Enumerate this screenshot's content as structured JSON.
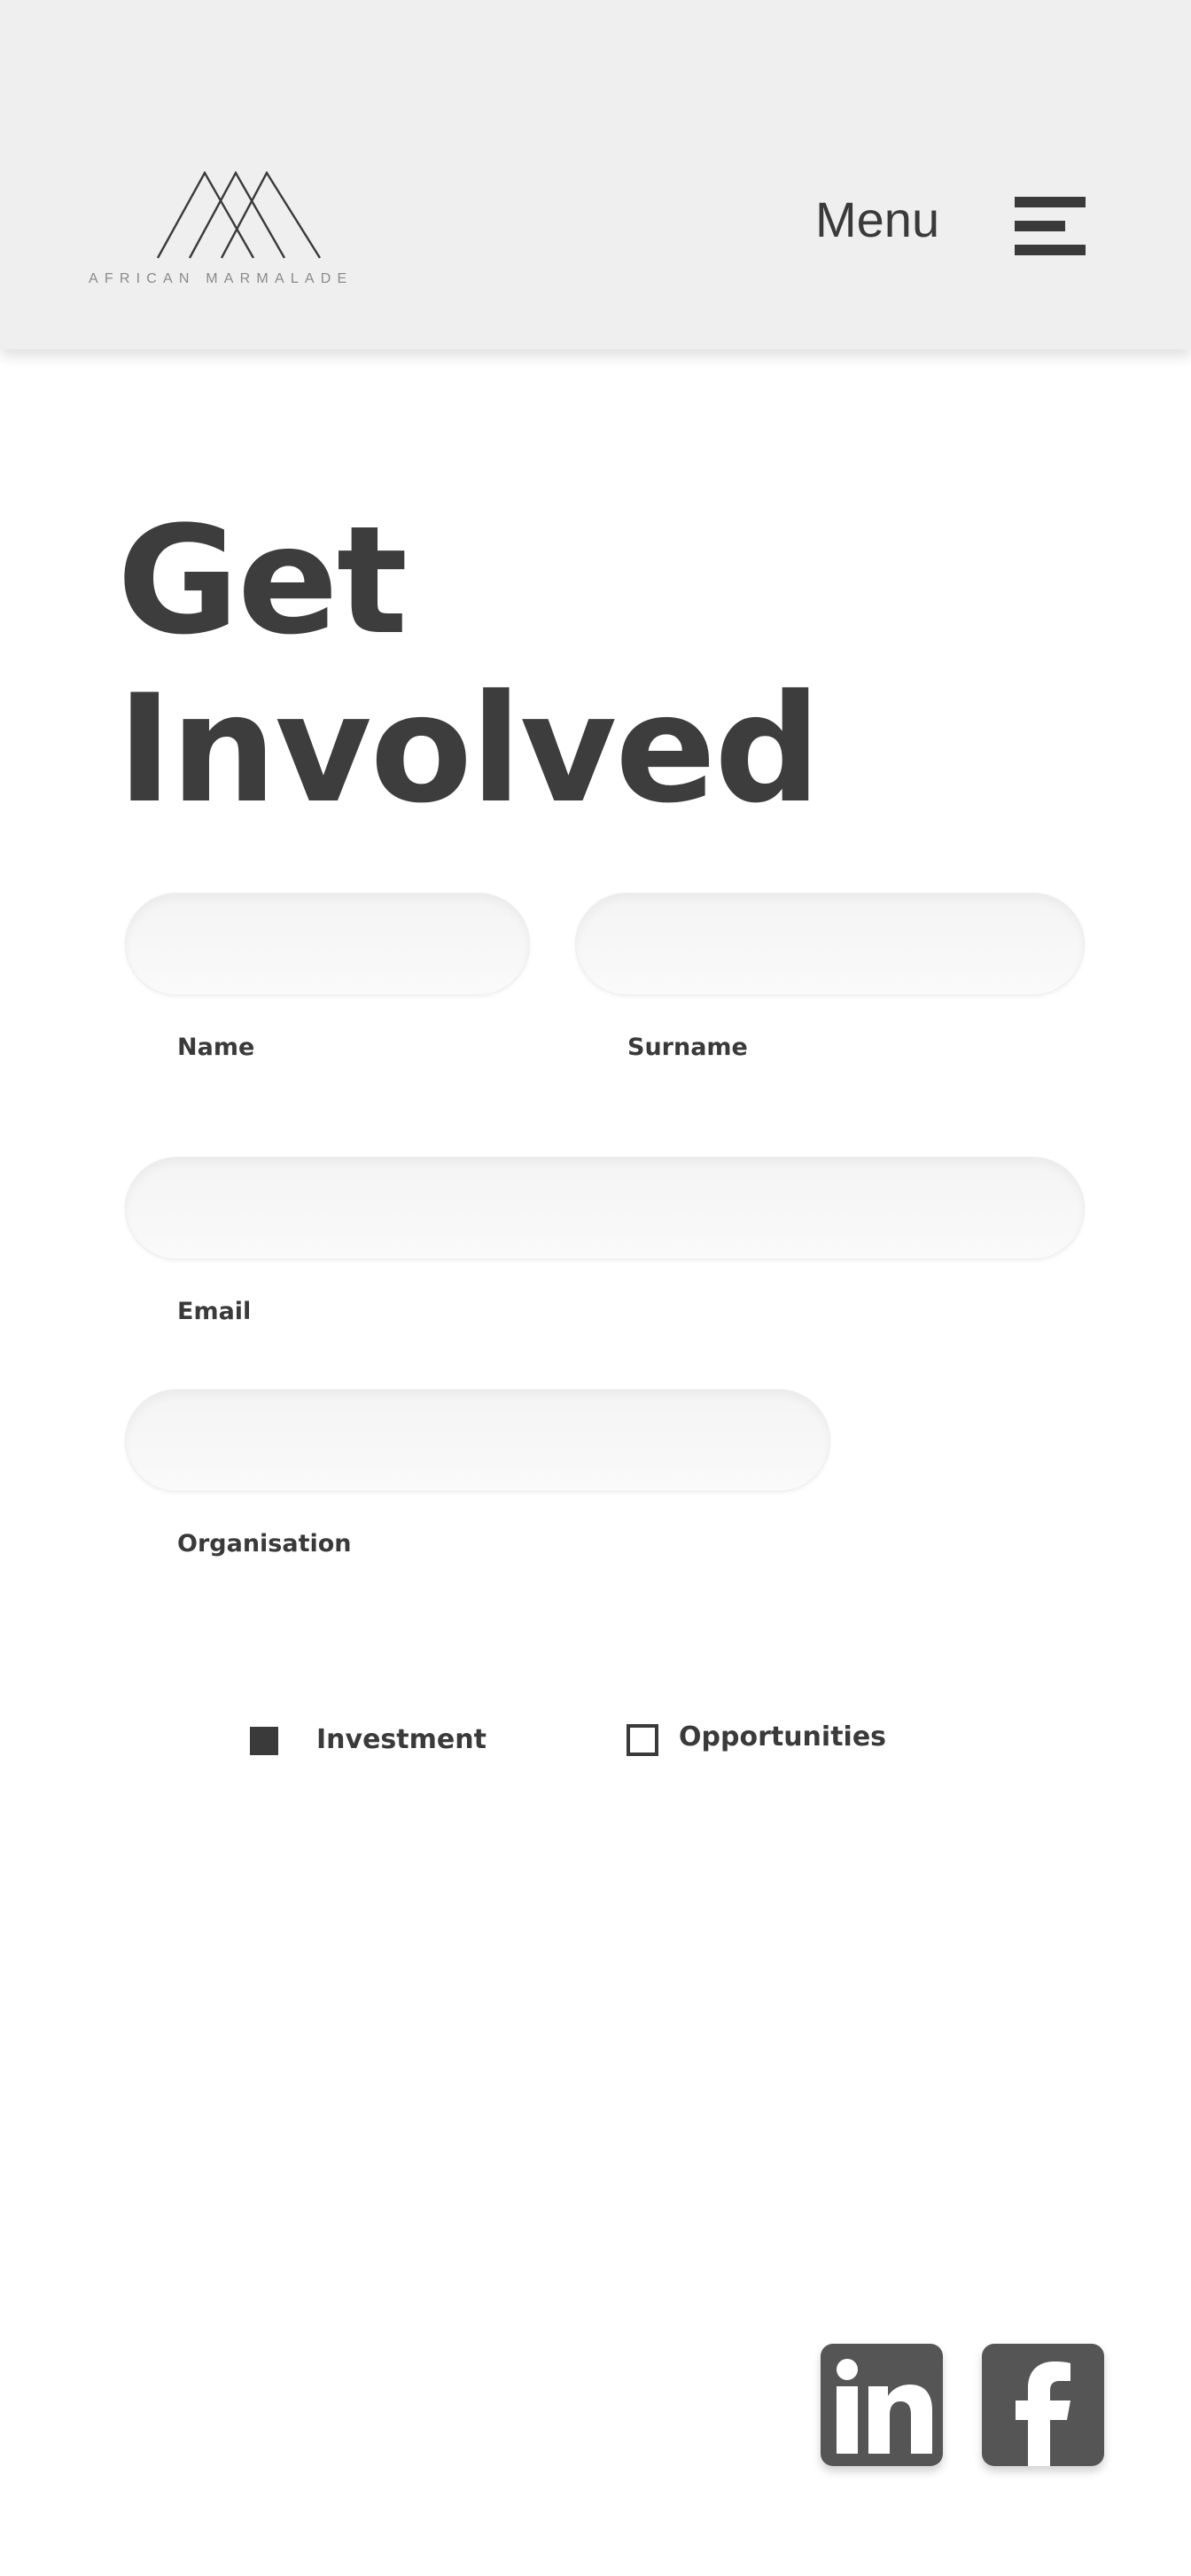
{
  "header": {
    "brand": "AFRICAN MARMALADE",
    "menu_label": "Menu",
    "icons": {
      "logo": "mountain-peaks-logo",
      "menu": "hamburger-icon"
    }
  },
  "page": {
    "title_line1": "Get",
    "title_line2": "Involved"
  },
  "form": {
    "name": {
      "label": "Name",
      "value": "",
      "placeholder": ""
    },
    "surname": {
      "label": "Surname",
      "value": "",
      "placeholder": ""
    },
    "email": {
      "label": "Email",
      "value": "",
      "placeholder": ""
    },
    "organisation": {
      "label": "Organisation",
      "value": "",
      "placeholder": ""
    },
    "options": [
      {
        "label": "Investment",
        "checked": true
      },
      {
        "label": "Opportunities",
        "checked": false
      }
    ]
  },
  "social": {
    "linkedin_icon": "linkedin-icon",
    "facebook_icon": "facebook-icon"
  },
  "colors": {
    "header_bg": "#efefef",
    "text": "#3a3a3a",
    "social_bg": "#555555"
  }
}
